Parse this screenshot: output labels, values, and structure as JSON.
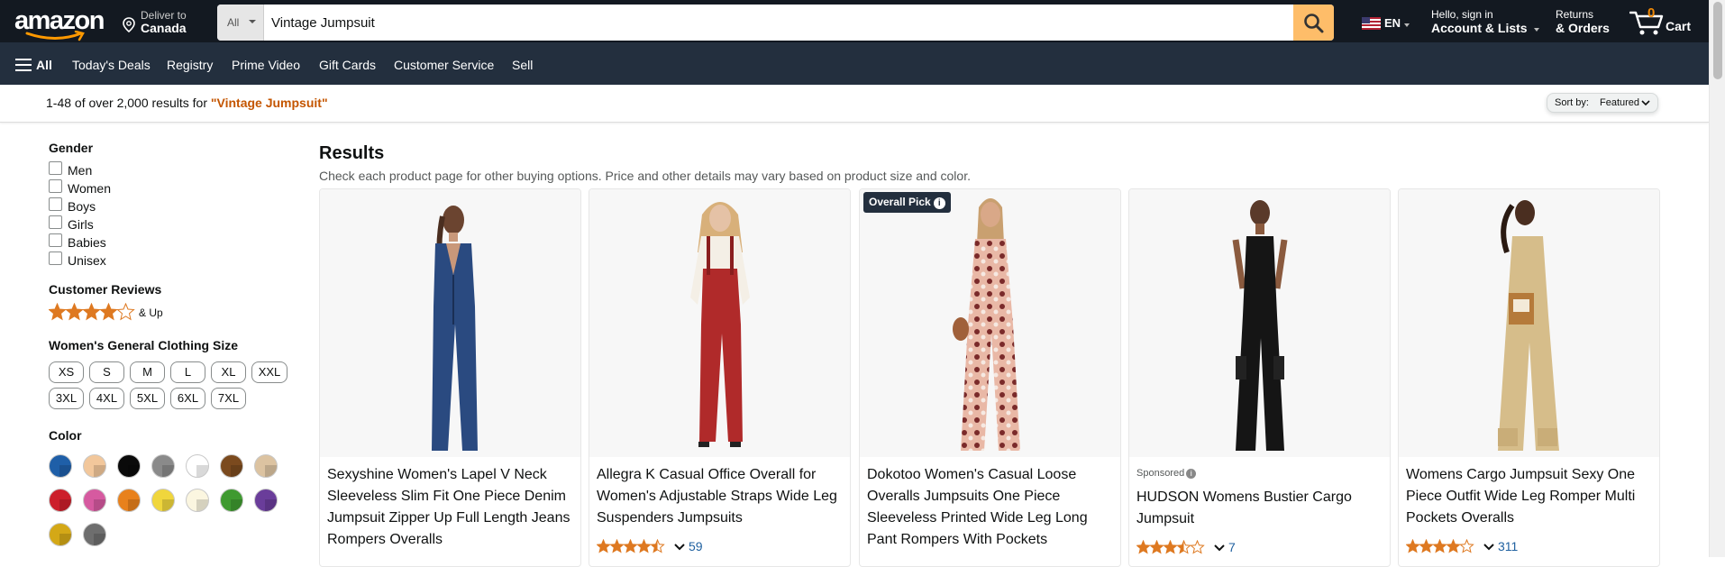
{
  "header": {
    "logo_text": "amazon",
    "deliver_line1": "Deliver to",
    "deliver_line2": "Canada",
    "search": {
      "department": "All",
      "value": "Vintage Jumpsuit",
      "icon": "search-icon"
    },
    "language": "EN",
    "account_line1": "Hello, sign in",
    "account_line2": "Account & Lists",
    "returns_line1": "Returns",
    "returns_line2": "& Orders",
    "cart_count": "0",
    "cart_label": "Cart"
  },
  "nav": {
    "all_label": "All",
    "items": [
      "Today's Deals",
      "Registry",
      "Prime Video",
      "Gift Cards",
      "Customer Service",
      "Sell"
    ]
  },
  "results_bar": {
    "count_text": "1-48 of over 2,000 results for ",
    "query_text": "\"Vintage Jumpsuit\"",
    "sort_label": "Sort by:",
    "sort_value": "Featured"
  },
  "sidebar": {
    "gender_heading": "Gender",
    "genders": [
      "Men",
      "Women",
      "Boys",
      "Girls",
      "Babies",
      "Unisex"
    ],
    "reviews_heading": "Customer Reviews",
    "reviews_stars": 4,
    "reviews_up": "& Up",
    "size_heading": "Women's General Clothing Size",
    "sizes_row1": [
      "XS",
      "S",
      "M",
      "L",
      "XL",
      "XXL"
    ],
    "sizes_row2": [
      "3XL",
      "4XL",
      "5XL",
      "6XL",
      "7XL"
    ],
    "color_heading": "Color",
    "colors": [
      "#1f5fa8",
      "#f2c79b",
      "#0a0a0a",
      "#8a8a8a",
      "#ffffff",
      "#7b4a1e",
      "#dcc3a1",
      "#cc1f2b",
      "#d65aa0",
      "#e8811c",
      "#f0d63c",
      "#fbf6e0",
      "#3f9a30",
      "#6a3d9a",
      "#d4a817",
      "#6e6e6e"
    ]
  },
  "results": {
    "heading": "Results",
    "subtext": "Check each product page for other buying options. Price and other details may vary based on product size and color."
  },
  "badge": {
    "label": "Overall Pick",
    "icon": "info-icon"
  },
  "products": [
    {
      "title": "Sexyshine Women's Lapel V Neck Sleeveless Slim Fit One Piece Denim Jumpsuit Zipper Up Full Length Jeans Rompers Overalls",
      "sponsored": "",
      "rating": null,
      "rating_count": ""
    },
    {
      "title": "Allegra K Casual Office Overall for Women's Adjustable Straps Wide Leg Suspenders Jumpsuits",
      "sponsored": "",
      "rating": 4.5,
      "rating_count": "59"
    },
    {
      "title": "Dokotoo Women's Casual Loose Overalls Jumpsuits One Piece Sleeveless Printed Wide Leg Long Pant Rompers With Pockets",
      "sponsored": "",
      "rating": null,
      "rating_count": ""
    },
    {
      "title": "HUDSON Womens Bustier Cargo Jumpsuit",
      "sponsored": "Sponsored",
      "rating": 3.5,
      "rating_count": "7"
    },
    {
      "title": "Womens Cargo Jumpsuit Sexy One Piece Outfit Wide Leg Romper Multi Pockets Overalls",
      "sponsored": "",
      "rating": 4,
      "rating_count": "311"
    }
  ]
}
